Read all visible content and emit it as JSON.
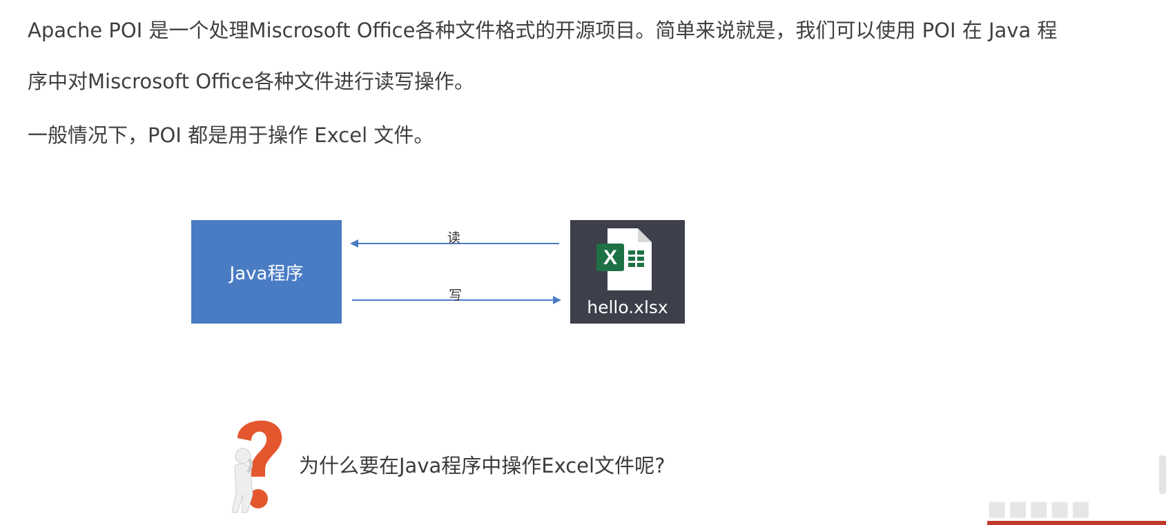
{
  "content": {
    "paragraph1_line1": "Apache POI 是一个处理Miscrosoft Office各种文件格式的开源项目。简单来说就是，我们可以使用 POI 在 Java 程",
    "paragraph1_line2": "序中对Miscrosoft Office各种文件进行读写操作。",
    "paragraph2": "一般情况下，POI 都是用于操作 Excel 文件。"
  },
  "diagram": {
    "java_box_label": "Java程序",
    "file_label": "hello.xlsx",
    "read_label": "读",
    "write_label": "写",
    "java_box_color": "#4a7cc4",
    "file_tile_color": "#3d3f4a",
    "arrow_color": "#4a7cc4"
  },
  "question": {
    "text": "为什么要在Java程序中操作Excel文件呢?"
  },
  "icons": {
    "excel": "excel-file-icon",
    "question": "question-mark-figure-icon"
  }
}
